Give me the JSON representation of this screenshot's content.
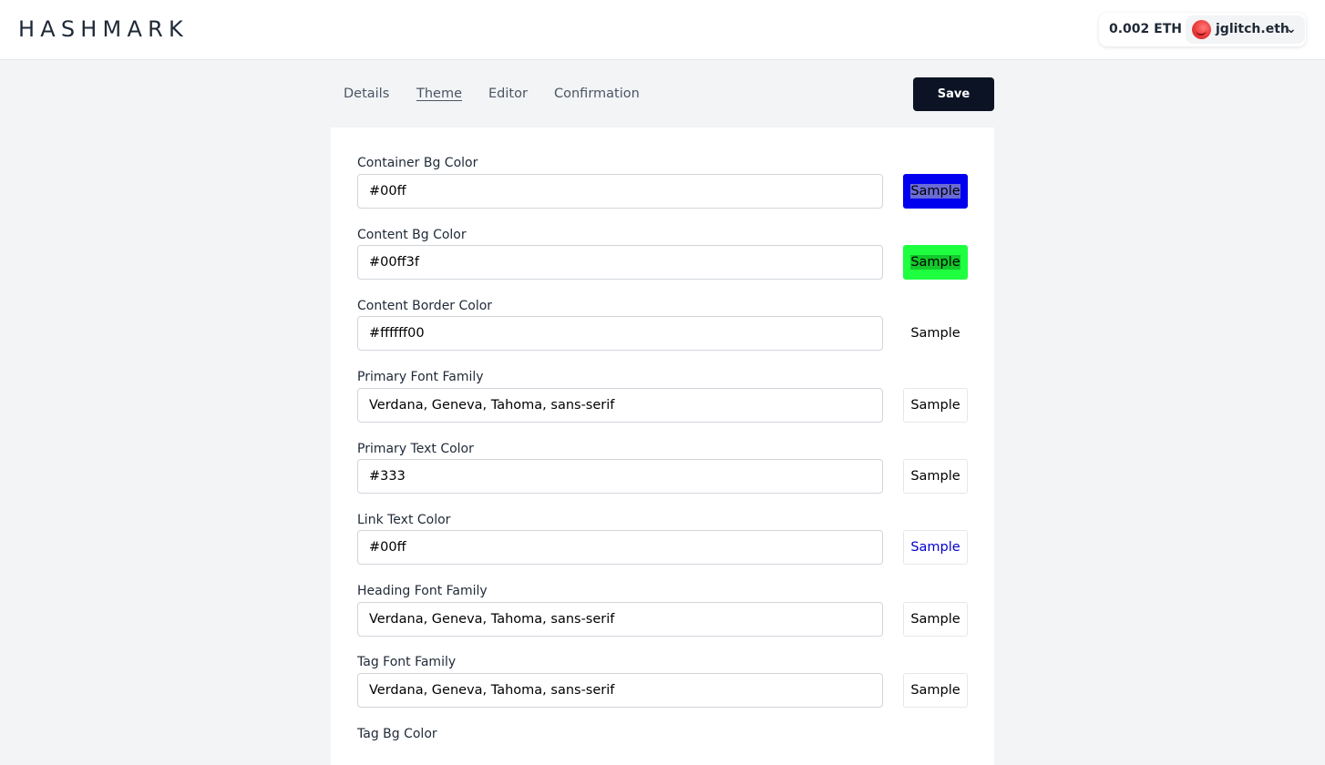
{
  "header": {
    "logo": "HASHMARK",
    "balance": "0.002 ETH",
    "account": "jglitch.eth",
    "account_chevron": "❯"
  },
  "tabs": [
    {
      "label": "Details",
      "active": false
    },
    {
      "label": "Theme",
      "active": true
    },
    {
      "label": "Editor",
      "active": false
    },
    {
      "label": "Confirmation",
      "active": false
    }
  ],
  "toolbar": {
    "save_label": "Save"
  },
  "sample_label": "Sample",
  "fields": [
    {
      "label": "Container Bg Color",
      "value": "#00ff"
    },
    {
      "label": "Content Bg Color",
      "value": "#00ff3f"
    },
    {
      "label": "Content Border Color",
      "value": "#ffffff00"
    },
    {
      "label": "Primary Font Family",
      "value": "Verdana, Geneva, Tahoma, sans-serif"
    },
    {
      "label": "Primary Text Color",
      "value": "#333"
    },
    {
      "label": "Link Text Color",
      "value": "#00ff"
    },
    {
      "label": "Heading Font Family",
      "value": "Verdana, Geneva, Tahoma, sans-serif"
    },
    {
      "label": "Tag Font Family",
      "value": "Verdana, Geneva, Tahoma, sans-serif"
    },
    {
      "label": "Tag Bg Color",
      "value": ""
    }
  ],
  "colors": {
    "save_button": "#0b1324",
    "page_bg": "#f3f4f6",
    "sample_container_bg": "#0000ee",
    "sample_content_bg": "#1eff3f",
    "sample_link_text": "#0000cc"
  }
}
